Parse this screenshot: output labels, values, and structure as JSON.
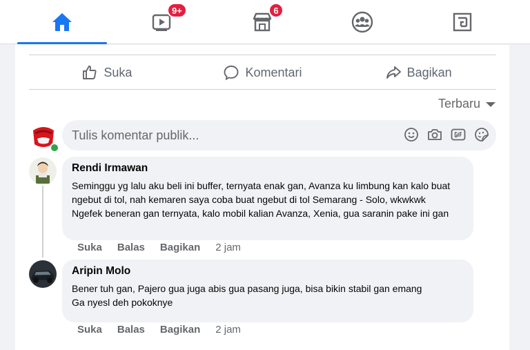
{
  "nav": {
    "tabs": [
      {
        "name": "home",
        "icon": "home-icon",
        "active": true
      },
      {
        "name": "watch",
        "icon": "video-icon",
        "badge": "9+"
      },
      {
        "name": "marketplace",
        "icon": "store-icon",
        "badge": "6"
      },
      {
        "name": "groups",
        "icon": "groups-icon"
      },
      {
        "name": "gaming",
        "icon": "gaming-icon"
      }
    ]
  },
  "actions": {
    "like": "Suka",
    "comment": "Komentari",
    "share": "Bagikan"
  },
  "sort": {
    "label": "Terbaru"
  },
  "composer": {
    "placeholder": "Tulis komentar publik...",
    "icons": [
      "smiley-icon",
      "camera-icon",
      "gif-icon",
      "sticker-icon"
    ]
  },
  "comments": [
    {
      "author": "Rendi Irmawan",
      "text": "Seminggu yg lalu aku beli ini buffer, ternyata enak gan, Avanza ku limbung kan kalo buat\nngebut di tol, nah kemaren saya coba buat ngebut di tol Semarang - Solo, wkwkwk\nNgefek beneran gan ternyata, kalo mobil kalian Avanza, Xenia, gua saranin pake ini gan",
      "like": "Suka",
      "reply": "Balas",
      "share": "Bagikan",
      "time": "2 jam"
    },
    {
      "author": "Aripin Molo",
      "text": "Bener tuh gan, Pajero gua juga abis gua pasang juga, bisa bikin stabil gan emang\nGa nyesl deh pokoknye",
      "like": "Suka",
      "reply": "Balas",
      "share": "Bagikan",
      "time": "2 jam"
    }
  ],
  "colors": {
    "accent": "#1877f2",
    "badge": "#e41e3f",
    "online": "#31a24c"
  }
}
